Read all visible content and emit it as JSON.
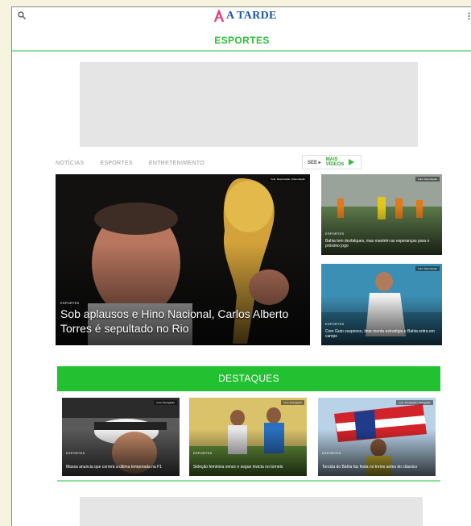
{
  "header": {
    "logo_text": "A TARDE",
    "section_title": "ESPORTES"
  },
  "nav": {
    "tabs": [
      "NOTÍCIAS",
      "ESPORTES",
      "ENTRETENIMENTO"
    ],
    "video_label": "SEE ▸",
    "video_brand_line1": "MAIS",
    "video_brand_line2": "VÍDEOS"
  },
  "featured": {
    "main": {
      "label": "ESPORTES",
      "title": "Sob aplausos e Hino Nacional, Carlos Alberto Torres é sepultado no Rio",
      "credit": "Foto: Reprodução | Reprodução"
    },
    "side": [
      {
        "label": "ESPORTES",
        "title": "Bahia tem desfalques, mas mantém as esperanças para o próximo jogo",
        "credit": "Foto: Reprodução"
      },
      {
        "label": "ESPORTES",
        "title": "Com Guto suspenso, time monta estratégia e Bahia entra em campo",
        "credit": "Foto: Reprodução"
      }
    ]
  },
  "destaques": {
    "title": "DESTAQUES",
    "items": [
      {
        "label": "ESPORTES",
        "title": "Massa anuncia que correrá a última temporada na F1",
        "credit": "Foto: Divulgação"
      },
      {
        "label": "ESPORTES",
        "title": "Seleção feminina vence e segue invicta no torneio",
        "credit": "Foto: Divulgação"
      },
      {
        "label": "ESPORTES",
        "title": "Torcida do Bahia faz festa no treino antes do clássico",
        "credit": "Foto: Divulgação | Divulgação"
      }
    ]
  },
  "colors": {
    "brand_green": "#22c132",
    "logo_blue": "#1b57a6",
    "logo_pink": "#e23b7d"
  }
}
